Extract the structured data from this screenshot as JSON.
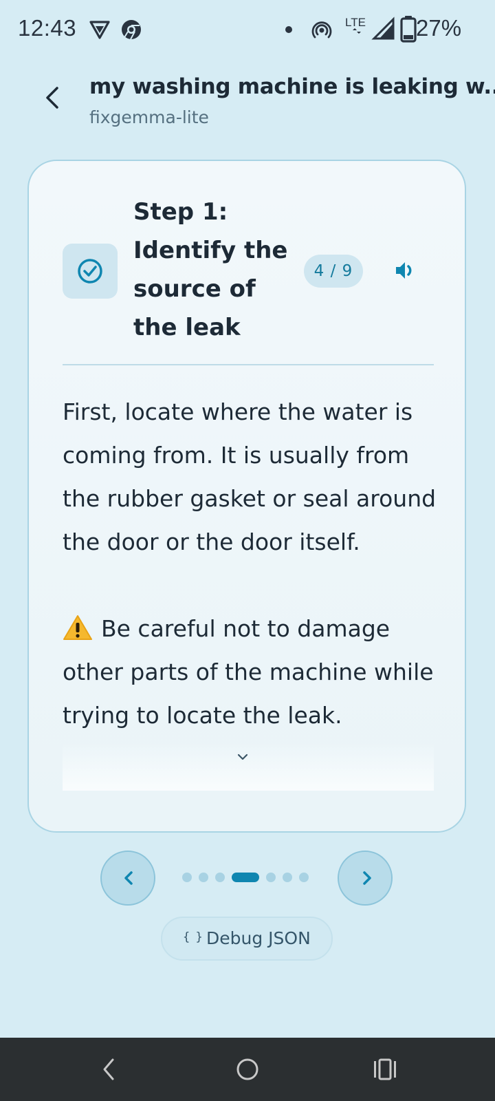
{
  "status_bar": {
    "time": "12:43",
    "battery": "27%",
    "icons": [
      "vpn-icon",
      "chrome-icon",
      "notification-dot",
      "hotspot-icon",
      "lte-icon",
      "signal-icon",
      "battery-icon"
    ]
  },
  "header": {
    "back_icon": "chevron-left-icon",
    "title": "my washing machine is leaking w...",
    "subtitle": "fixgemma-lite"
  },
  "step": {
    "icon": "check-circle-icon",
    "title": "Step 1: Identify the source of the leak",
    "counter": "4 / 9",
    "speak_icon": "speaker-icon",
    "body": "First, locate where the water is coming from. It is usually from the rubber gasket or seal around the door or the door itself.",
    "warning_icon": "warning-icon",
    "warning": "Be careful not to damage other parts of the machine while trying to locate the leak.",
    "scroll_icon": "chevron-down-icon"
  },
  "pager": {
    "prev_icon": "chevron-left-icon",
    "next_icon": "chevron-right-icon",
    "total": 7,
    "current_index": 3
  },
  "debug_button": {
    "icon": "braces-icon",
    "label": "Debug JSON"
  },
  "system_nav": {
    "icons": [
      "back-icon",
      "home-icon",
      "recents-icon"
    ]
  },
  "colors": {
    "background": "#d6ecf4",
    "accent": "#0f86b0",
    "card_border": "#a9d4e4",
    "text": "#1d2a36",
    "warning": "#f5b82e"
  }
}
